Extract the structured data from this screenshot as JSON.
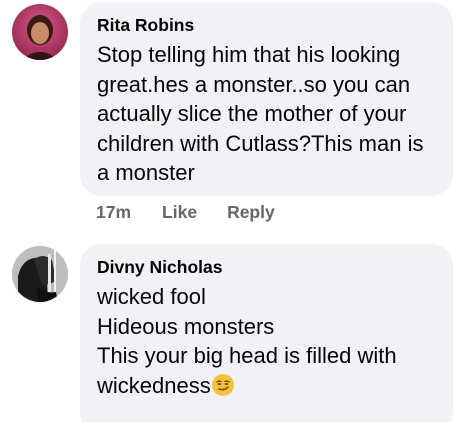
{
  "comments": [
    {
      "author": "Rita Robins",
      "text": "Stop telling him that his looking great.hes a monster..so you can actually slice the mother of your children with Cutlass?This man is a monster",
      "time": "17m",
      "like_label": "Like",
      "reply_label": "Reply",
      "avatar_icon": "profile-photo"
    },
    {
      "author": "Divny Nicholas",
      "lines": [
        "wicked fool",
        "Hideous monsters",
        "This your big head is filled with",
        "wickedness"
      ],
      "emoji": "smirking-face-emoji",
      "avatar_icon": "profile-photo"
    }
  ],
  "colors": {
    "bubble": "#f0f2f5",
    "text": "#050505",
    "meta": "#65676b",
    "emoji_yellow": "#f7c23b"
  }
}
